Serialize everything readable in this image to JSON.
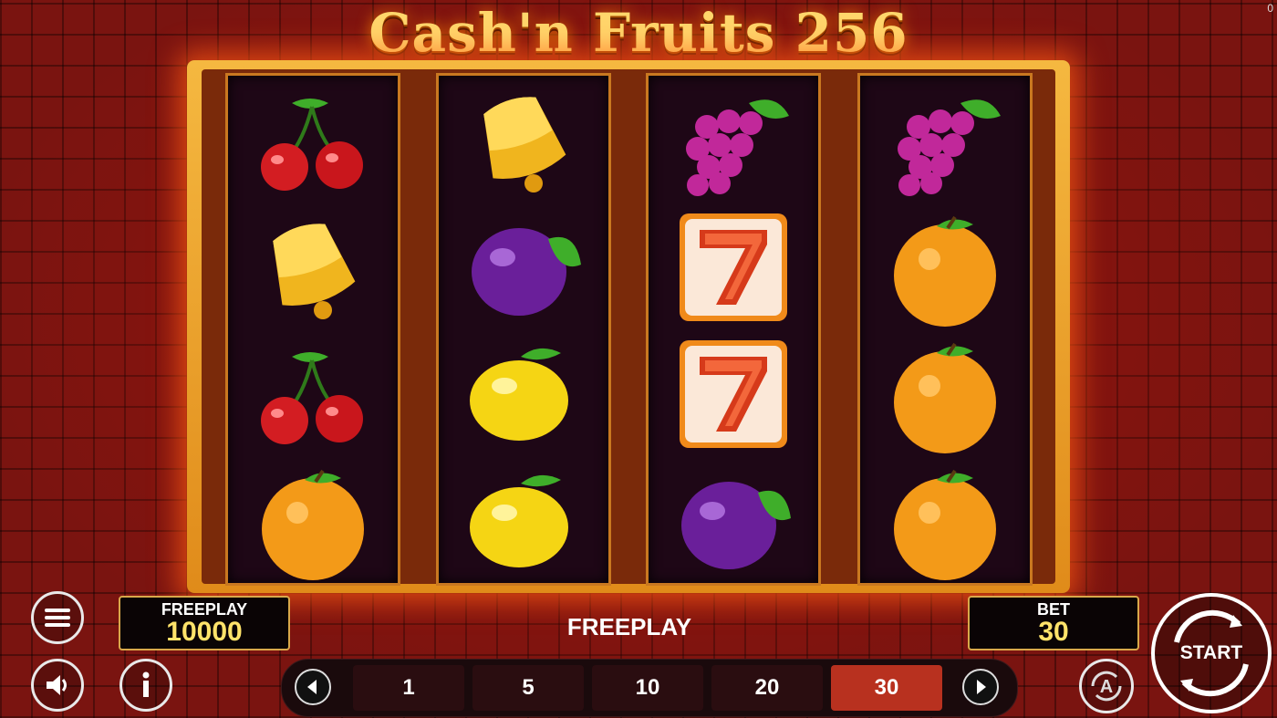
{
  "game_title": "Cash'n Fruits 256",
  "corner_counter": "0",
  "reels": [
    [
      "cherry",
      "bell",
      "cherry",
      "orange"
    ],
    [
      "bell",
      "plum",
      "lemon",
      "lemon"
    ],
    [
      "grapes",
      "seven",
      "seven",
      "plum"
    ],
    [
      "grapes",
      "orange",
      "orange",
      "orange"
    ]
  ],
  "balance": {
    "label": "FREEPLAY",
    "value": "10000"
  },
  "message": "FREEPLAY",
  "bet": {
    "label": "BET",
    "value": "30"
  },
  "bet_options": [
    "1",
    "5",
    "10",
    "20",
    "30"
  ],
  "selected_bet": "30",
  "start_label": "START",
  "autoplay_label": "A",
  "icons": {
    "menu": "menu-icon",
    "sound": "speaker-icon",
    "info": "info-icon",
    "prev": "arrow-left-icon",
    "next": "arrow-right-icon",
    "autoplay": "autoplay-icon",
    "start": "spin-arrows-icon"
  },
  "colors": {
    "frame_gold": "#f5b840",
    "reel_bg": "#1e0716",
    "selected_chip": "#b8311f",
    "value_yellow": "#ffe36a"
  }
}
